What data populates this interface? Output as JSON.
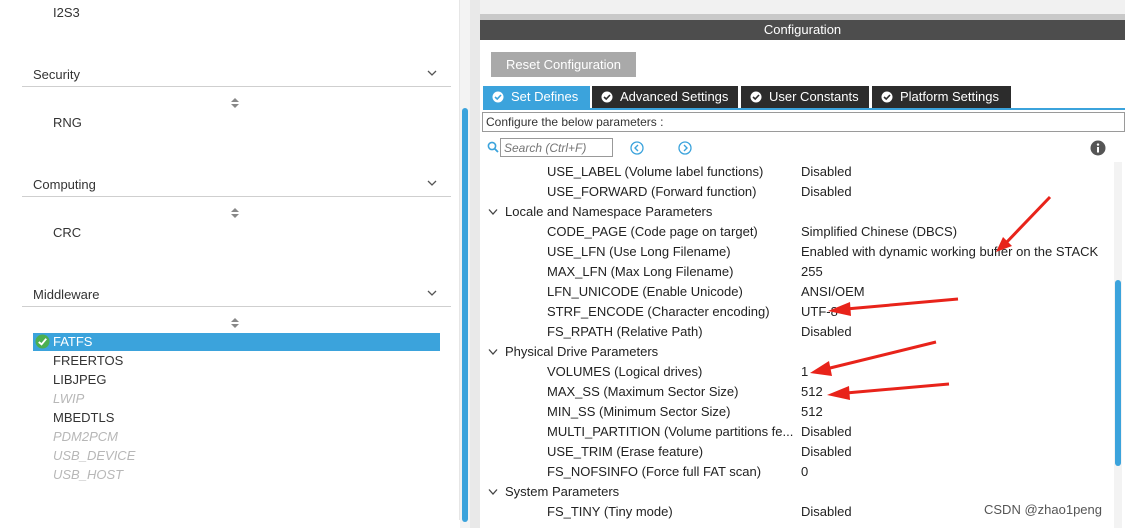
{
  "left": {
    "top_item": "I2S3",
    "sections": [
      {
        "title": "Security",
        "items": [
          "RNG"
        ]
      },
      {
        "title": "Computing",
        "items": [
          "CRC"
        ]
      },
      {
        "title": "Middleware"
      }
    ],
    "middleware_items": [
      {
        "label": "FATFS",
        "state": "selected"
      },
      {
        "label": "FREERTOS",
        "state": "enabled"
      },
      {
        "label": "LIBJPEG",
        "state": "enabled"
      },
      {
        "label": "LWIP",
        "state": "disabled"
      },
      {
        "label": "MBEDTLS",
        "state": "enabled"
      },
      {
        "label": "PDM2PCM",
        "state": "disabled"
      },
      {
        "label": "USB_DEVICE",
        "state": "disabled"
      },
      {
        "label": "USB_HOST",
        "state": "disabled"
      }
    ]
  },
  "right": {
    "header": "Configuration",
    "reset_button": "Reset Configuration",
    "tabs": [
      "Set Defines",
      "Advanced Settings",
      "User Constants",
      "Platform Settings"
    ],
    "active_tab": "Set Defines",
    "configure_text": "Configure the below parameters :",
    "search_placeholder": "Search (Ctrl+F)",
    "rows": [
      {
        "kind": "param",
        "name": "USE_LABEL (Volume label functions)",
        "value": "Disabled"
      },
      {
        "kind": "param",
        "name": "USE_FORWARD (Forward function)",
        "value": "Disabled"
      },
      {
        "kind": "group",
        "name": "Locale and Namespace Parameters"
      },
      {
        "kind": "param",
        "name": "CODE_PAGE (Code page on target)",
        "value": "Simplified Chinese (DBCS)"
      },
      {
        "kind": "param",
        "name": "USE_LFN (Use Long Filename)",
        "value": "Enabled with dynamic working buffer on the STACK"
      },
      {
        "kind": "param",
        "name": "MAX_LFN (Max Long Filename)",
        "value": "255"
      },
      {
        "kind": "param",
        "name": "LFN_UNICODE (Enable Unicode)",
        "value": "ANSI/OEM"
      },
      {
        "kind": "param",
        "name": "STRF_ENCODE (Character encoding)",
        "value": "UTF-8"
      },
      {
        "kind": "param",
        "name": "FS_RPATH (Relative Path)",
        "value": "Disabled"
      },
      {
        "kind": "group",
        "name": "Physical Drive Parameters"
      },
      {
        "kind": "param",
        "name": "VOLUMES (Logical drives)",
        "value": "1"
      },
      {
        "kind": "param",
        "name": "MAX_SS (Maximum Sector Size)",
        "value": "512"
      },
      {
        "kind": "param",
        "name": "MIN_SS (Minimum Sector Size)",
        "value": "512"
      },
      {
        "kind": "param",
        "name": "MULTI_PARTITION (Volume partitions fe...",
        "value": "Disabled"
      },
      {
        "kind": "param",
        "name": "USE_TRIM (Erase feature)",
        "value": "Disabled"
      },
      {
        "kind": "param",
        "name": "FS_NOFSINFO (Force full FAT scan)",
        "value": "0"
      },
      {
        "kind": "group",
        "name": "System Parameters"
      },
      {
        "kind": "param",
        "name": "FS_TINY (Tiny mode)",
        "value": "Disabled"
      }
    ]
  },
  "watermark": "CSDN @zhao1peng",
  "colors": {
    "accent": "#3ba3dc",
    "header_bg": "#4d4d4d",
    "tab_bg": "#2c2c2c",
    "annotation_arrow": "#e8231a"
  },
  "icons": [
    "chevron-down-icon",
    "sort-icon",
    "check-circle-icon",
    "search-icon",
    "arrow-left-circle-icon",
    "arrow-right-circle-icon",
    "info-icon"
  ]
}
